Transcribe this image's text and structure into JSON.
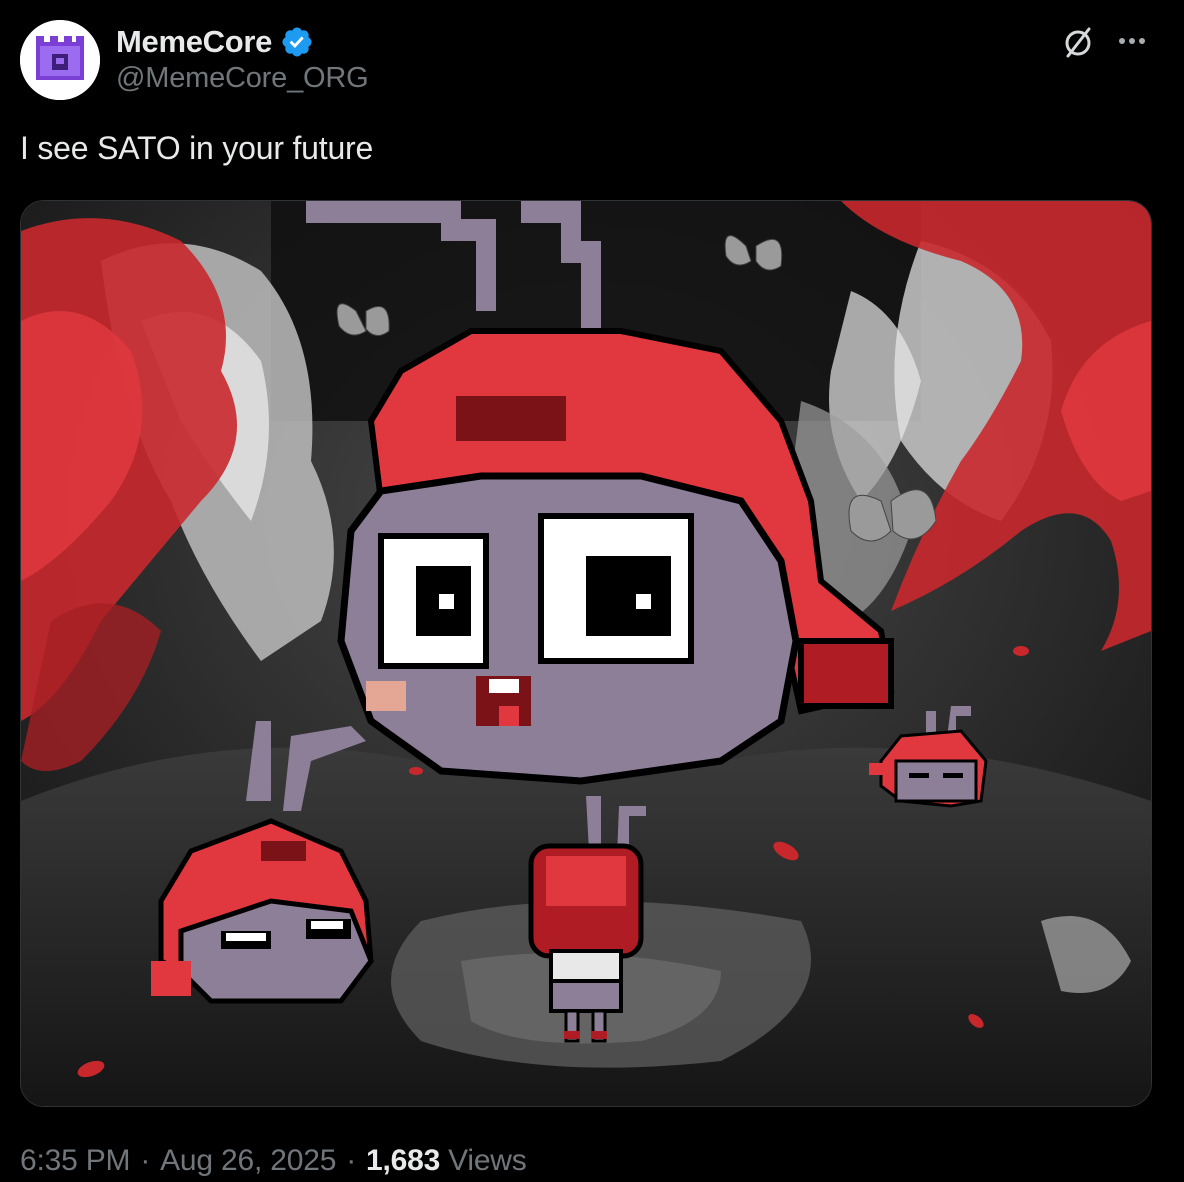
{
  "author": {
    "display_name": "MemeCore",
    "handle": "@MemeCore_ORG",
    "verified": true,
    "avatar_icon": "memecore-logo-icon"
  },
  "tweet": {
    "text": "I see SATO in your future"
  },
  "media": {
    "description_icon": "sato-pixel-ant-artwork"
  },
  "meta": {
    "time": "6:35 PM",
    "separator": "·",
    "date": "Aug 26, 2025",
    "views_count": "1,683",
    "views_label": "Views"
  },
  "colors": {
    "background": "#000000",
    "text_primary": "#e7e9ea",
    "text_secondary": "#71767b",
    "verified_blue": "#1d9bf0",
    "accent_red": "#e0383e"
  },
  "icons": {
    "verified": "verified-badge-icon",
    "grok": "grok-icon",
    "more": "more-options-icon"
  }
}
